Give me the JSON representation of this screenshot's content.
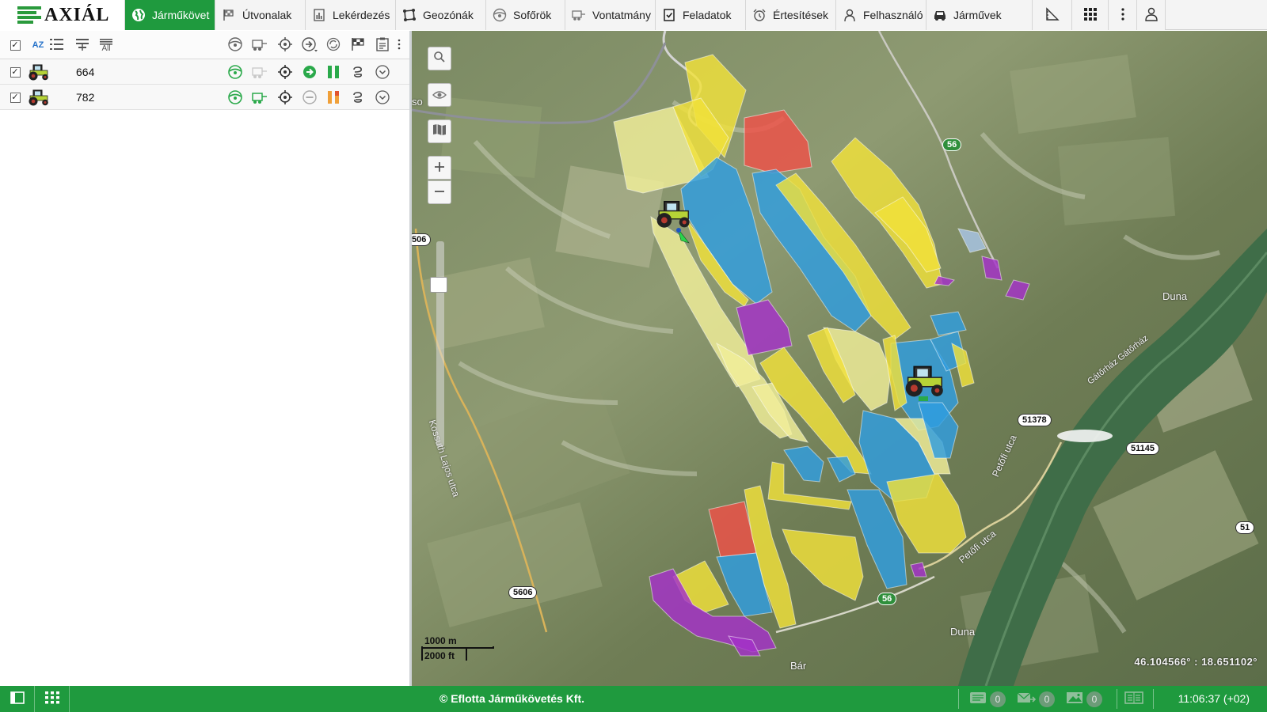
{
  "brand": {
    "logo_text": "AXIÁL",
    "accent": "#1f9a3e"
  },
  "nav": {
    "tabs": [
      {
        "label": "Járműkövet",
        "icon": "globe-icon",
        "active": true
      },
      {
        "label": "Útvonalak",
        "icon": "route-flag-icon"
      },
      {
        "label": "Lekérdezés",
        "icon": "report-chart-icon"
      },
      {
        "label": "Geozónák",
        "icon": "geozone-icon"
      },
      {
        "label": "Sofőrök",
        "icon": "steering-wheel-icon"
      },
      {
        "label": "Vontatmány",
        "icon": "trailer-icon"
      },
      {
        "label": "Feladatok",
        "icon": "task-checklist-icon"
      },
      {
        "label": "Értesítések",
        "icon": "alarm-clock-icon"
      },
      {
        "label": "Felhasználó",
        "icon": "user-icon"
      },
      {
        "label": "Járművek",
        "icon": "car-icon"
      }
    ],
    "right_icons": [
      "ruler-icon",
      "grid-apps-icon",
      "more-vertical-icon",
      "account-icon"
    ]
  },
  "vehicle_list": {
    "toolbar_icons": [
      "select-all-checkbox",
      "sort-az-icon",
      "list-icon",
      "filter-list-icon",
      "all-list-icon",
      "driver-icon",
      "trailer-icon",
      "locate-icon",
      "direction-icon",
      "refresh-icon",
      "flag-icon",
      "clipboard-icon",
      "more-icon"
    ],
    "sort_label": "AZ",
    "all_label": "All",
    "vehicles": [
      {
        "name": "664",
        "checked": true,
        "trailer_active": false,
        "status": "moving"
      },
      {
        "name": "782",
        "checked": true,
        "trailer_active": true,
        "status": "stopped"
      }
    ]
  },
  "map": {
    "labels": {
      "duna_1": "Duna",
      "duna_2": "Duna",
      "gatorhaz": "Gátőrház Gátőrház",
      "kossuth": "Kossuth Lajos utca",
      "petofi_1": "Petőfi utca",
      "petofi_2": "Petőfi utca",
      "bar": "Bár",
      "so": "so"
    },
    "road_shields": {
      "r56a": "56",
      "r56b": "56",
      "r51378": "51378",
      "r51145": "51145",
      "r5606": "5606",
      "r506": "506",
      "r51": "51"
    },
    "scale": {
      "metric": "1000 m",
      "imperial": "2000 ft"
    },
    "coordinates": "46.104566° : 18.651102°",
    "zone_colors": {
      "yellow": "#f1e23a",
      "light_yellow": "#f2ef9a",
      "blue": "#2f9ee0",
      "red": "#ef5148",
      "purple": "#a531c9"
    }
  },
  "statusbar": {
    "copyright": "© Eflotta Járműkövetés Kft.",
    "messages_count": "0",
    "sent_count": "0",
    "images_count": "0",
    "time": "11:06:37 (+02)"
  }
}
